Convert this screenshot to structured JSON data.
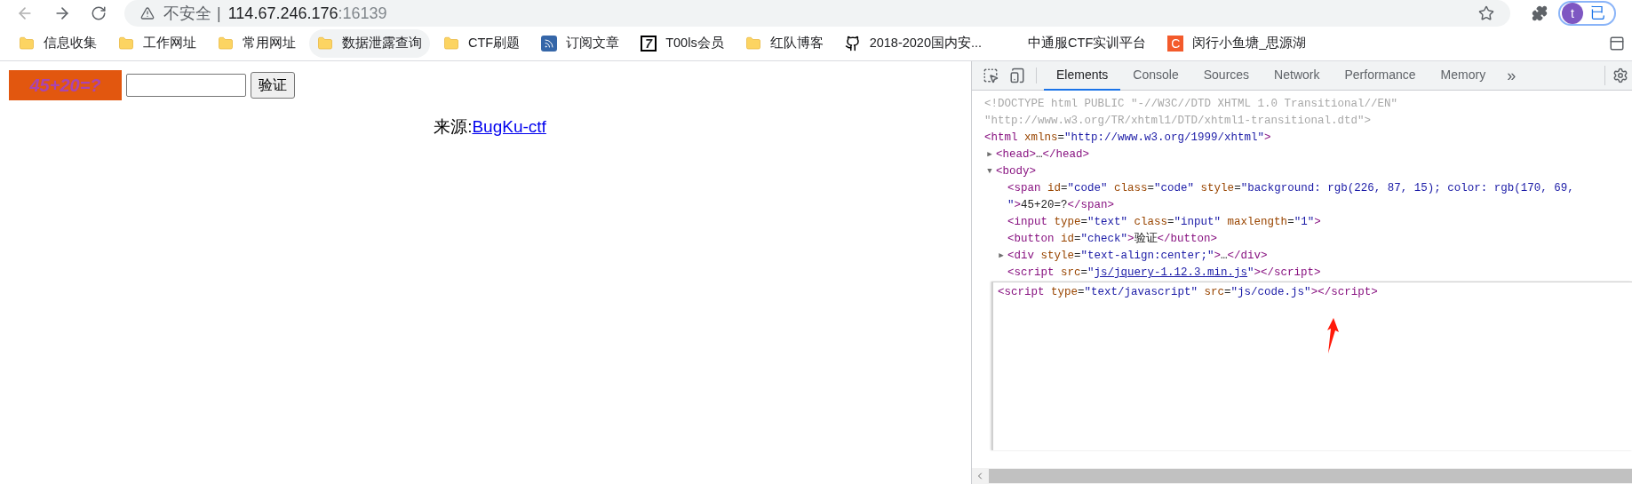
{
  "browser": {
    "security_label": "不安全",
    "separator": "|",
    "host": "114.67.246.176",
    "port": ":16139",
    "profile_initial": "t",
    "profile_status": "已"
  },
  "bookmarks": [
    {
      "label": "信息收集",
      "kind": "folder",
      "hovered": false
    },
    {
      "label": "工作网址",
      "kind": "folder",
      "hovered": false
    },
    {
      "label": "常用网址",
      "kind": "folder",
      "hovered": false
    },
    {
      "label": "数据泄露查询",
      "kind": "folder",
      "hovered": true
    },
    {
      "label": "CTF刷题",
      "kind": "folder",
      "hovered": false
    },
    {
      "label": "订阅文章",
      "kind": "rss",
      "hovered": false
    },
    {
      "label": "T00ls会员",
      "kind": "badge",
      "badge_text": "7",
      "hovered": false
    },
    {
      "label": "红队博客",
      "kind": "folder",
      "hovered": false
    },
    {
      "label": "2018-2020国内安...",
      "kind": "github",
      "hovered": false
    },
    {
      "label": "中通服CTF实训平台",
      "kind": "blank",
      "hovered": false
    },
    {
      "label": "闵行小鱼塘_思源湖",
      "kind": "letter",
      "badge_text": "C",
      "hovered": false
    }
  ],
  "page": {
    "captcha": "45+20=?",
    "button": "验证",
    "source_label": "来源:",
    "source_link": "BugKu-ctf"
  },
  "devtools": {
    "tabs": [
      {
        "label": "Elements",
        "selected": true
      },
      {
        "label": "Console",
        "selected": false
      },
      {
        "label": "Sources",
        "selected": false
      },
      {
        "label": "Network",
        "selected": false
      },
      {
        "label": "Performance",
        "selected": false
      },
      {
        "label": "Memory",
        "selected": false
      }
    ],
    "more_tabs": "»",
    "tree": [
      {
        "kind": "doctype",
        "lines": [
          "<!DOCTYPE html PUBLIC \"-//W3C//DTD XHTML 1.0 Transitional//EN\"",
          "\"http://www.w3.org/TR/xhtml1/DTD/xhtml1-transitional.dtd\">"
        ]
      },
      {
        "kind": "node",
        "tokens": [
          {
            "kind": "tag",
            "t": "<html"
          },
          {
            "kind": "attr",
            "t": " xmlns"
          },
          {
            "kind": "eq",
            "t": "="
          },
          {
            "kind": "value",
            "t": "\"http://www.w3.org/1999/xhtml\""
          },
          {
            "kind": "tag",
            "t": ">"
          }
        ],
        "children": [
          {
            "kind": "node",
            "toggle": "▶",
            "tokens": [
              {
                "kind": "tag",
                "t": "<head>"
              },
              {
                "kind": "text",
                "t": "…"
              },
              {
                "kind": "tag",
                "t": "</head>"
              }
            ]
          },
          {
            "kind": "node",
            "toggle": "▼",
            "tokens": [
              {
                "kind": "tag",
                "t": "<body>"
              }
            ],
            "children": [
              {
                "kind": "node",
                "tokens": [
                  {
                    "kind": "tag",
                    "t": "<span"
                  },
                  {
                    "kind": "attr",
                    "t": " id"
                  },
                  {
                    "kind": "eq",
                    "t": "="
                  },
                  {
                    "kind": "value",
                    "t": "\"code\""
                  },
                  {
                    "kind": "attr",
                    "t": " class"
                  },
                  {
                    "kind": "eq",
                    "t": "="
                  },
                  {
                    "kind": "value",
                    "t": "\"code\""
                  },
                  {
                    "kind": "attr",
                    "t": " style"
                  },
                  {
                    "kind": "eq",
                    "t": "="
                  },
                  {
                    "kind": "value",
                    "t": "\"background: rgb(226, 87, 15); color: rgb(170, 69,"
                  },
                  {
                    "kind": "break"
                  },
                  {
                    "kind": "value",
                    "t": "\""
                  },
                  {
                    "kind": "tag",
                    "t": ">"
                  },
                  {
                    "kind": "text",
                    "t": "45+20=?"
                  },
                  {
                    "kind": "tag",
                    "t": "</span>"
                  }
                ]
              },
              {
                "kind": "node",
                "tokens": [
                  {
                    "kind": "tag",
                    "t": "<input"
                  },
                  {
                    "kind": "attr",
                    "t": " type"
                  },
                  {
                    "kind": "eq",
                    "t": "="
                  },
                  {
                    "kind": "value",
                    "t": "\"text\""
                  },
                  {
                    "kind": "attr",
                    "t": " class"
                  },
                  {
                    "kind": "eq",
                    "t": "="
                  },
                  {
                    "kind": "value",
                    "t": "\"input\""
                  },
                  {
                    "kind": "attr",
                    "t": " maxlength"
                  },
                  {
                    "kind": "eq",
                    "t": "="
                  },
                  {
                    "kind": "value",
                    "t": "\"1\""
                  },
                  {
                    "kind": "tag",
                    "t": ">"
                  }
                ]
              },
              {
                "kind": "node",
                "tokens": [
                  {
                    "kind": "tag",
                    "t": "<button"
                  },
                  {
                    "kind": "attr",
                    "t": " id"
                  },
                  {
                    "kind": "eq",
                    "t": "="
                  },
                  {
                    "kind": "value",
                    "t": "\"check\""
                  },
                  {
                    "kind": "tag",
                    "t": ">"
                  },
                  {
                    "kind": "text",
                    "t": "验证"
                  },
                  {
                    "kind": "tag",
                    "t": "</button>"
                  }
                ]
              },
              {
                "kind": "node",
                "toggle": "▶",
                "tokens": [
                  {
                    "kind": "tag",
                    "t": "<div"
                  },
                  {
                    "kind": "attr",
                    "t": " style"
                  },
                  {
                    "kind": "eq",
                    "t": "="
                  },
                  {
                    "kind": "value",
                    "t": "\"text-align:center;\""
                  },
                  {
                    "kind": "tag",
                    "t": ">"
                  },
                  {
                    "kind": "text",
                    "t": "…"
                  },
                  {
                    "kind": "tag",
                    "t": "</div>"
                  }
                ]
              },
              {
                "kind": "node",
                "tokens": [
                  {
                    "kind": "tag",
                    "t": "<script"
                  },
                  {
                    "kind": "attr",
                    "t": " src"
                  },
                  {
                    "kind": "eq",
                    "t": "="
                  },
                  {
                    "kind": "value",
                    "t": "\""
                  },
                  {
                    "kind": "link",
                    "t": "js/jquery-1.12.3.min.js"
                  },
                  {
                    "kind": "value",
                    "t": "\""
                  },
                  {
                    "kind": "tag",
                    "t": "></script>"
                  }
                ]
              },
              {
                "kind": "editor",
                "tokens": [
                  {
                    "kind": "tag",
                    "t": "<script"
                  },
                  {
                    "kind": "attr",
                    "t": " type"
                  },
                  {
                    "kind": "eq",
                    "t": "="
                  },
                  {
                    "kind": "value",
                    "t": "\"text/javascript\""
                  },
                  {
                    "kind": "attr",
                    "t": " src"
                  },
                  {
                    "kind": "eq",
                    "t": "="
                  },
                  {
                    "kind": "value",
                    "t": "\"js/code.js\""
                  },
                  {
                    "kind": "tag",
                    "t": "></script>"
                  }
                ]
              }
            ]
          }
        ]
      }
    ]
  }
}
